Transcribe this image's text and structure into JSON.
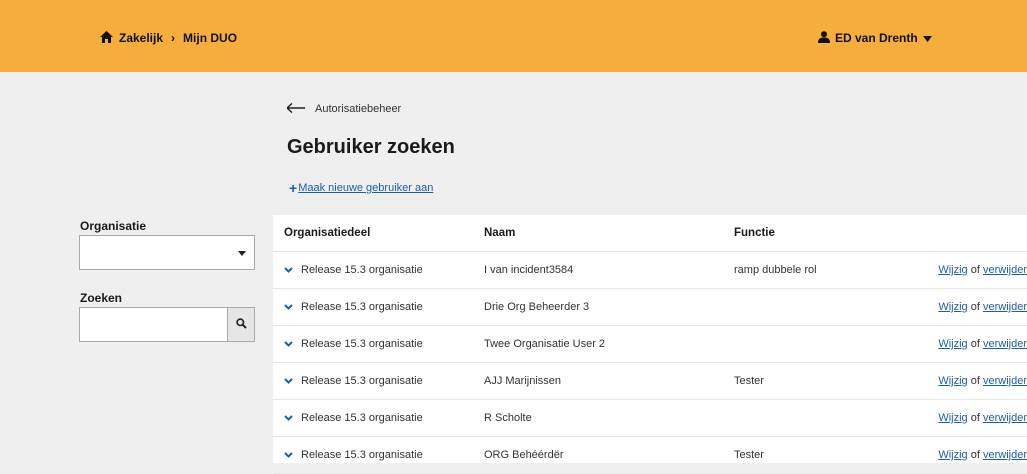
{
  "header": {
    "breadcrumb": [
      "Zakelijk",
      "Mijn DUO"
    ],
    "breadcrumb_separator": "›",
    "user_name": "ED van Drenth"
  },
  "page": {
    "back_label": "Autorisatiebeheer",
    "title": "Gebruiker zoeken",
    "new_user_plus": "+",
    "new_user_label": "Maak nieuwe gebruiker aan"
  },
  "filters": {
    "organisatie_label": "Organisatie",
    "organisatie_value": "",
    "zoeken_label": "Zoeken",
    "zoeken_value": ""
  },
  "table": {
    "columns": [
      "Organisatiedeel",
      "Naam",
      "Functie",
      ""
    ],
    "edit_label": "Wijzig",
    "or_label": "of",
    "delete_label": "verwijder",
    "rows": [
      {
        "organisatiedeel": "Release 15.3 organisatie",
        "naam": "I van incident3584",
        "functie": "ramp dubbele rol"
      },
      {
        "organisatiedeel": "Release 15.3 organisatie",
        "naam": "Drie Org Beheerder 3",
        "functie": ""
      },
      {
        "organisatiedeel": "Release 15.3 organisatie",
        "naam": "Twee Organisatie User 2",
        "functie": ""
      },
      {
        "organisatiedeel": "Release 15.3 organisatie",
        "naam": "AJJ Marijnissen",
        "functie": "Tester"
      },
      {
        "organisatiedeel": "Release 15.3 organisatie",
        "naam": "R Scholte",
        "functie": ""
      },
      {
        "organisatiedeel": "Release 15.3 organisatie",
        "naam": "ORG Behéérdër",
        "functie": "Tester"
      }
    ]
  },
  "colors": {
    "header_bg": "#f5ad3b",
    "page_bg": "#efefef",
    "link": "#1d5ea8"
  },
  "icons": {
    "home": "home-icon",
    "user": "user-icon",
    "back": "arrow-left-icon",
    "dropdown": "caret-down-icon",
    "search": "search-icon",
    "row_expand": "chevron-down-icon"
  }
}
